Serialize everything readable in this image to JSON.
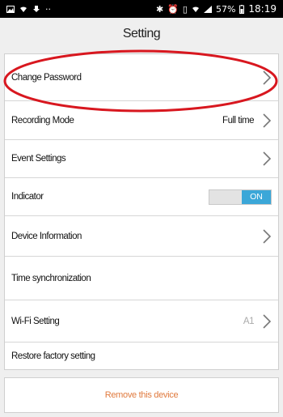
{
  "status_bar": {
    "battery": "57%",
    "time": "18:19",
    "left_icons": [
      "image-icon",
      "wifi-icon",
      "download-icon",
      "more-icon"
    ],
    "right_icons": [
      "bluetooth-icon",
      "alarm-icon",
      "vibrate-icon",
      "wifi-icon",
      "signal-icon",
      "battery-icon"
    ]
  },
  "header": {
    "title": "Setting"
  },
  "settings": {
    "change_password": "Change Password",
    "recording_mode": "Recording Mode",
    "recording_mode_value": "Full time",
    "event_settings": "Event Settings",
    "indicator": "Indicator",
    "indicator_state": "ON",
    "device_information": "Device Information",
    "time_sync": "Time synchronization",
    "wifi_setting": "Wi-Fi Setting",
    "wifi_value": "A1",
    "restore": "Restore factory setting"
  },
  "footer": {
    "remove_label": "Remove this device"
  },
  "colors": {
    "toggle_on": "#3ba7d8",
    "remove_text": "#e07a3e",
    "highlight": "#d8171f"
  }
}
